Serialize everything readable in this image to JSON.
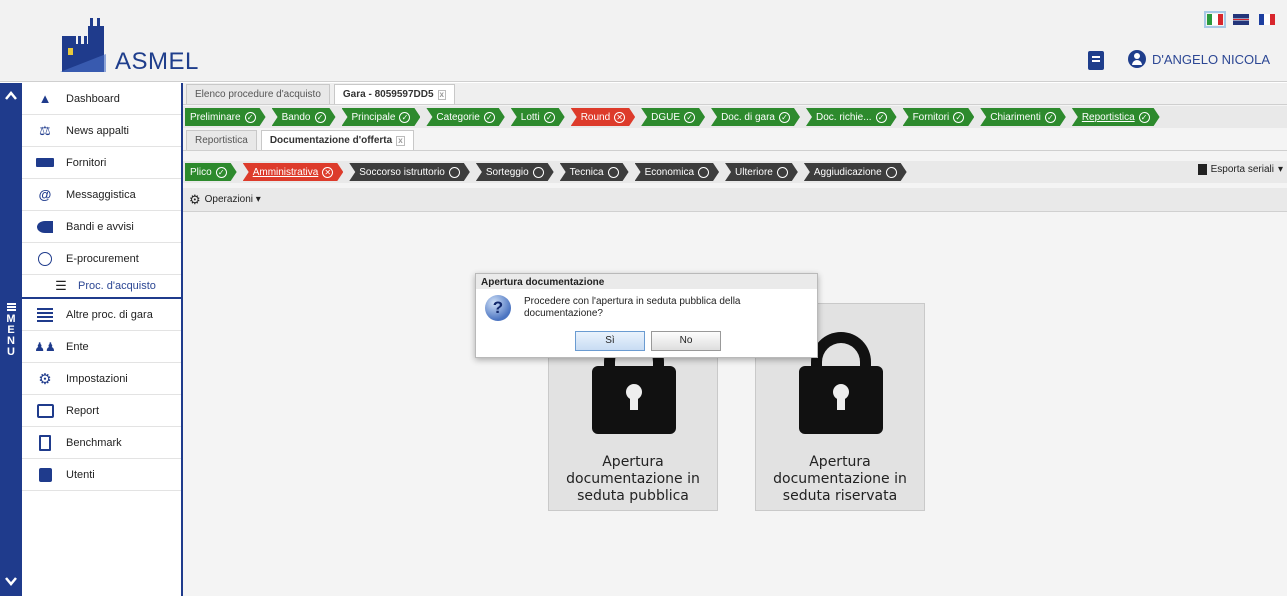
{
  "header": {
    "brand": "ASMEL",
    "user_name": "D'ANGELO NICOLA",
    "languages": [
      "it",
      "en",
      "fr"
    ]
  },
  "rail": {
    "menu_letters": [
      "M",
      "E",
      "N",
      "U"
    ],
    "up": "^",
    "down": "v"
  },
  "sidebar": {
    "items": [
      {
        "label": "Dashboard",
        "icon": "home-icon"
      },
      {
        "label": "News appalti",
        "icon": "scales-icon"
      },
      {
        "label": "Fornitori",
        "icon": "truck-icon"
      },
      {
        "label": "Messaggistica",
        "icon": "at-icon"
      },
      {
        "label": "Bandi e avvisi",
        "icon": "megaphone-icon"
      },
      {
        "label": "E-procurement",
        "icon": "coins-icon"
      },
      {
        "label": "Proc. d'acquisto",
        "icon": "list-icon",
        "sub": true
      },
      {
        "label": "Altre proc. di gara",
        "icon": "stack-icon"
      },
      {
        "label": "Ente",
        "icon": "people-icon"
      },
      {
        "label": "Impostazioni",
        "icon": "gear-icon"
      },
      {
        "label": "Report",
        "icon": "chart-icon"
      },
      {
        "label": "Benchmark",
        "icon": "document-icon"
      },
      {
        "label": "Utenti",
        "icon": "id-card-icon"
      }
    ]
  },
  "top_tabs": [
    {
      "label": "Elenco procedure d'acquisto",
      "active": false
    },
    {
      "label": "Gara - 8059597DD5",
      "active": true
    }
  ],
  "gara_steps": [
    {
      "label": "Preliminare",
      "status": "ok"
    },
    {
      "label": "Bando",
      "status": "ok"
    },
    {
      "label": "Principale",
      "status": "ok"
    },
    {
      "label": "Categorie",
      "status": "ok"
    },
    {
      "label": "Lotti",
      "status": "ok"
    },
    {
      "label": "Round",
      "status": "error"
    },
    {
      "label": "DGUE",
      "status": "ok"
    },
    {
      "label": "Doc. di gara",
      "status": "ok"
    },
    {
      "label": "Doc. richie...",
      "status": "ok"
    },
    {
      "label": "Fornitori",
      "status": "ok"
    },
    {
      "label": "Chiarimenti",
      "status": "ok"
    },
    {
      "label": "Reportistica",
      "status": "ok",
      "link": true
    }
  ],
  "sub_tabs": [
    {
      "label": "Reportistica",
      "active": false
    },
    {
      "label": "Documentazione d'offerta",
      "active": true
    }
  ],
  "offer_steps": [
    {
      "label": "Plico",
      "status": "ok",
      "color": "green"
    },
    {
      "label": "Amministrativa",
      "status": "error",
      "color": "red",
      "link": true
    },
    {
      "label": "Soccorso istruttorio",
      "status": "pending",
      "color": "dark"
    },
    {
      "label": "Sorteggio",
      "status": "pending",
      "color": "dark"
    },
    {
      "label": "Tecnica",
      "status": "pending",
      "color": "dark"
    },
    {
      "label": "Economica",
      "status": "pending",
      "color": "dark"
    },
    {
      "label": "Ulteriore",
      "status": "pending",
      "color": "dark"
    },
    {
      "label": "Aggiudicazione",
      "status": "pending",
      "color": "dark"
    }
  ],
  "export_label": "Esporta seriali",
  "operations_label": "Operazioni",
  "cards": [
    {
      "label": "Apertura documentazione in seduta pubblica",
      "lines": [
        "Apertura",
        "documentazione in",
        "seduta pubblica"
      ]
    },
    {
      "label": "Apertura documentazione in seduta riservata",
      "lines": [
        "Apertura",
        "documentazione in",
        "seduta riservata"
      ]
    }
  ],
  "dialog": {
    "title": "Apertura documentazione",
    "message": "Procedere con l'apertura in seduta pubblica della documentazione?",
    "message_lines": [
      "Procedere con l'apertura in seduta pubblica della",
      "documentazione?"
    ],
    "yes": "Sì",
    "no": "No"
  },
  "colors": {
    "brand_blue": "#1f3b8c",
    "ok_green": "#2d8a2d",
    "error_red": "#dd3b2b",
    "pending_dark": "#3d3d3d"
  }
}
